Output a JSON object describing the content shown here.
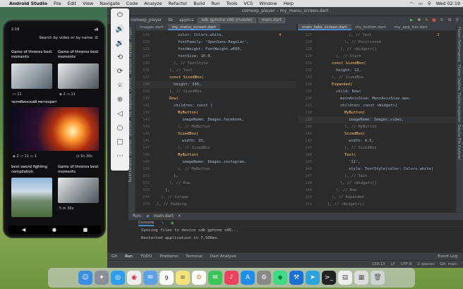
{
  "menubar": {
    "app": "Android Studio",
    "items": [
      "File",
      "Edit",
      "View",
      "Navigate",
      "Code",
      "Analyze",
      "Refactor",
      "Build",
      "Run",
      "Tools",
      "VCS",
      "Window",
      "Help"
    ],
    "clock": "Wed 02:19"
  },
  "ide": {
    "title": "comexp_player – my_menu_screen.dart",
    "breadcrumbs": [
      "comexp_player",
      "lib",
      "applics"
    ],
    "device": "sdk gphone x86 (mobile)",
    "run_config": "main.dart",
    "left_tabs": [
      "images.dart",
      "my_menu_screen.dart"
    ],
    "right_tabs": [
      "main_tabs_screen.dart",
      "my_button.dart",
      "my_app_bar.dart"
    ],
    "left_tool_labels": [
      "Project",
      "Resource Manager",
      "Commit",
      "Pull Requests",
      "Structure",
      "Favorites",
      "Build Variants"
    ],
    "right_tool_labels": [
      "Flutter Performance",
      "Flutter Outline",
      "Flutter Inspector",
      "Device File Explorer"
    ],
    "left_warnings": "4",
    "right_warnings": "3",
    "left_lines": [
      {
        "n": "131",
        "t": "color: Colors.white,"
      },
      {
        "n": "132",
        "t": "fontFamily: 'OpenSans-Regular',"
      },
      {
        "n": "133",
        "t": "fontWeight: FontWeight.w600,"
      },
      {
        "n": "134",
        "t": "fontSize: 10.0,"
      },
      {
        "n": "135",
        "t": "), // TextStyle"
      },
      {
        "n": "136",
        "t": "), // Text"
      },
      {
        "n": "137",
        "t": "const SizedBox("
      },
      {
        "n": "138",
        "t": "height: 340,"
      },
      {
        "n": "139",
        "t": "), // SizedBox"
      },
      {
        "n": "140",
        "t": "Row("
      },
      {
        "n": "141",
        "t": "children: const ["
      },
      {
        "n": "142",
        "t": "MyButton("
      },
      {
        "n": "143",
        "t": "imageName: Images.facebook,"
      },
      {
        "n": "144",
        "t": "), // MyButton"
      },
      {
        "n": "145",
        "t": "SizedBox("
      },
      {
        "n": "146",
        "t": "width: 10,"
      },
      {
        "n": "147",
        "t": "), // SizedBox"
      },
      {
        "n": "148",
        "t": "MyButton("
      },
      {
        "n": "149",
        "t": "imageName: Images.instagram,"
      },
      {
        "n": "150",
        "t": "), // MyButton"
      },
      {
        "n": "151",
        "t": "],"
      },
      {
        "n": "152",
        "t": "), // Row"
      },
      {
        "n": "153",
        "t": "],"
      },
      {
        "n": "154",
        "t": "), // Column"
      },
      {
        "n": "155",
        "t": "), // Padding"
      }
    ],
    "right_lines": [
      {
        "n": "127",
        "t": "), // Text"
      },
      {
        "n": "128",
        "t": "), // Positioned"
      },
      {
        "n": "129",
        "t": "], // <Widget>[]"
      },
      {
        "n": "130",
        "t": "), // Stack"
      },
      {
        "n": "131",
        "t": "const SizedBox("
      },
      {
        "n": "132",
        "t": "height: 12,"
      },
      {
        "n": "133",
        "t": "), // SizedBox"
      },
      {
        "n": "134",
        "t": "Expanded("
      },
      {
        "n": "135",
        "t": "child: Row("
      },
      {
        "n": "136",
        "t": "mainAxisSize: MainAxisSize.max,"
      },
      {
        "n": "137",
        "t": "children: const <Widget>["
      },
      {
        "n": "138",
        "t": "MyButton("
      },
      {
        "n": "139",
        "t": "imageName: Images.video,"
      },
      {
        "n": "140",
        "t": "), // MyButton"
      },
      {
        "n": "141",
        "t": "SizedBox("
      },
      {
        "n": "142",
        "t": "width: 4.5,"
      },
      {
        "n": "143",
        "t": "), // SizedBox"
      },
      {
        "n": "144",
        "t": "Text("
      },
      {
        "n": "145",
        "t": "'11',"
      },
      {
        "n": "146",
        "t": "style: TextStyle(color: Colors.white)"
      },
      {
        "n": "147",
        "t": "), // Text"
      },
      {
        "n": "148",
        "t": "], // <Widget>[]"
      },
      {
        "n": "149",
        "t": "), // Row"
      },
      {
        "n": "150",
        "t": "), // Expanded"
      },
      {
        "n": "151",
        "t": "], // <Widget>[]"
      }
    ],
    "run": {
      "label": "Run:",
      "config": "main.dart",
      "tabs": [
        "Console"
      ],
      "log": [
        "Syncing files to device sdk gphone x86...",
        "Restarted application in 7,506ms."
      ]
    },
    "bottom_tabs": [
      "Git",
      "Run",
      "TODO",
      "Problems",
      "Terminal",
      "Dart Analysis"
    ],
    "event_log": "Event Log",
    "status": [
      "138:13",
      "LF",
      "UTF-8",
      "2 spaces",
      "Git: main"
    ]
  },
  "phone": {
    "time": "2:19",
    "search": "Search by video or by name",
    "cards": [
      {
        "title": "Game of thrones best moments",
        "stats": [
          "11"
        ]
      },
      {
        "title": "Game of thrones best moments",
        "stats": [
          "2",
          "11"
        ]
      },
      {
        "title": "челябинский метеорит",
        "stats": [
          "2",
          "11",
          "1"
        ],
        "duration": "1h 30s"
      },
      {
        "title": "best sword fighting compilation",
        "stats": []
      },
      {
        "title": "Game of thrones best moments",
        "stats": [],
        "duration": "5 m 30s"
      }
    ]
  },
  "dock_apps": [
    "Finder",
    "Launchpad",
    "Safari",
    "Chrome",
    "Mail",
    "Calendar",
    "Notes",
    "Photos",
    "Messages",
    "Music",
    "App Store",
    "System Preferences",
    "Android Studio",
    "Xcode",
    "Telegram",
    "Terminal",
    "Preview",
    "Files",
    "Trash"
  ],
  "dock_calendar_day": "9",
  "colors": {
    "editor": "#2b2b2b",
    "panel": "#3c3f41",
    "keyword": "#cc7832",
    "class": "#ffc66d",
    "string": "#6a8759",
    "number": "#6897bb",
    "comment": "#808080"
  }
}
